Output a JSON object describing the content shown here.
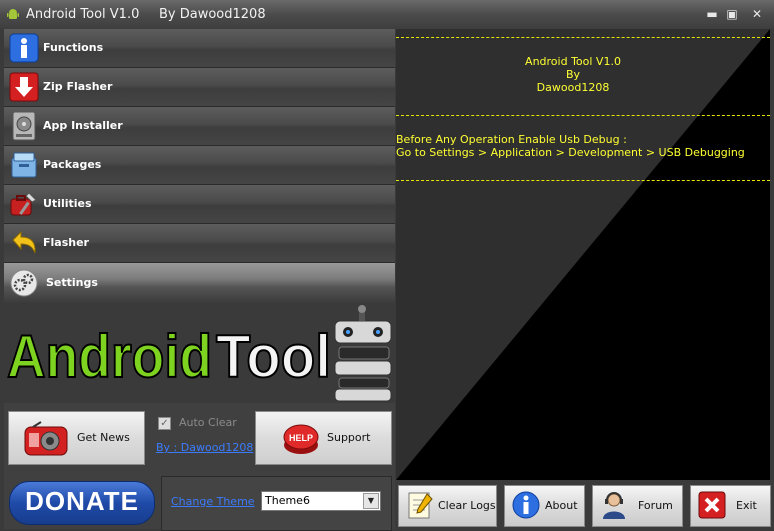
{
  "window": {
    "title": "Android Tool V1.0",
    "author": "By Dawood1208",
    "minimize": "▬",
    "maximize": "▣",
    "close": "✕"
  },
  "nav": {
    "items": [
      {
        "label": "Functions",
        "icon": "info-icon"
      },
      {
        "label": "Zip Flasher",
        "icon": "download-arrow-icon"
      },
      {
        "label": "App Installer",
        "icon": "hard-drive-icon"
      },
      {
        "label": "Packages",
        "icon": "package-box-icon"
      },
      {
        "label": "Utilities",
        "icon": "tools-icon"
      },
      {
        "label": "Flasher",
        "icon": "undo-arrow-icon"
      },
      {
        "label": "Settings",
        "icon": "gears-icon",
        "selected": true
      }
    ]
  },
  "logo": {
    "text_a": "Android",
    "text_b": "Tool"
  },
  "actions": {
    "get_news": "Get News",
    "support": "Support",
    "support_badge": "HELP",
    "auto_clear": "Auto Clear",
    "auto_clear_checked": true,
    "author_link": "By : Dawood1208",
    "donate": "DONATE",
    "change_theme": "Change Theme",
    "theme_value": "Theme6"
  },
  "console": {
    "line1": "Android Tool V1.0",
    "line2": "By",
    "line3": "Dawood1208",
    "line4": "Before Any Operation Enable Usb Debug :",
    "line5": "Go to Settings > Application > Development > USB Debugging"
  },
  "footer": {
    "clear_logs": "Clear Logs",
    "about": "About",
    "forum": "Forum",
    "exit": "Exit"
  },
  "colors": {
    "console_text": "#ffff33",
    "link": "#3b7cff",
    "donate": "#1f4aa8"
  }
}
